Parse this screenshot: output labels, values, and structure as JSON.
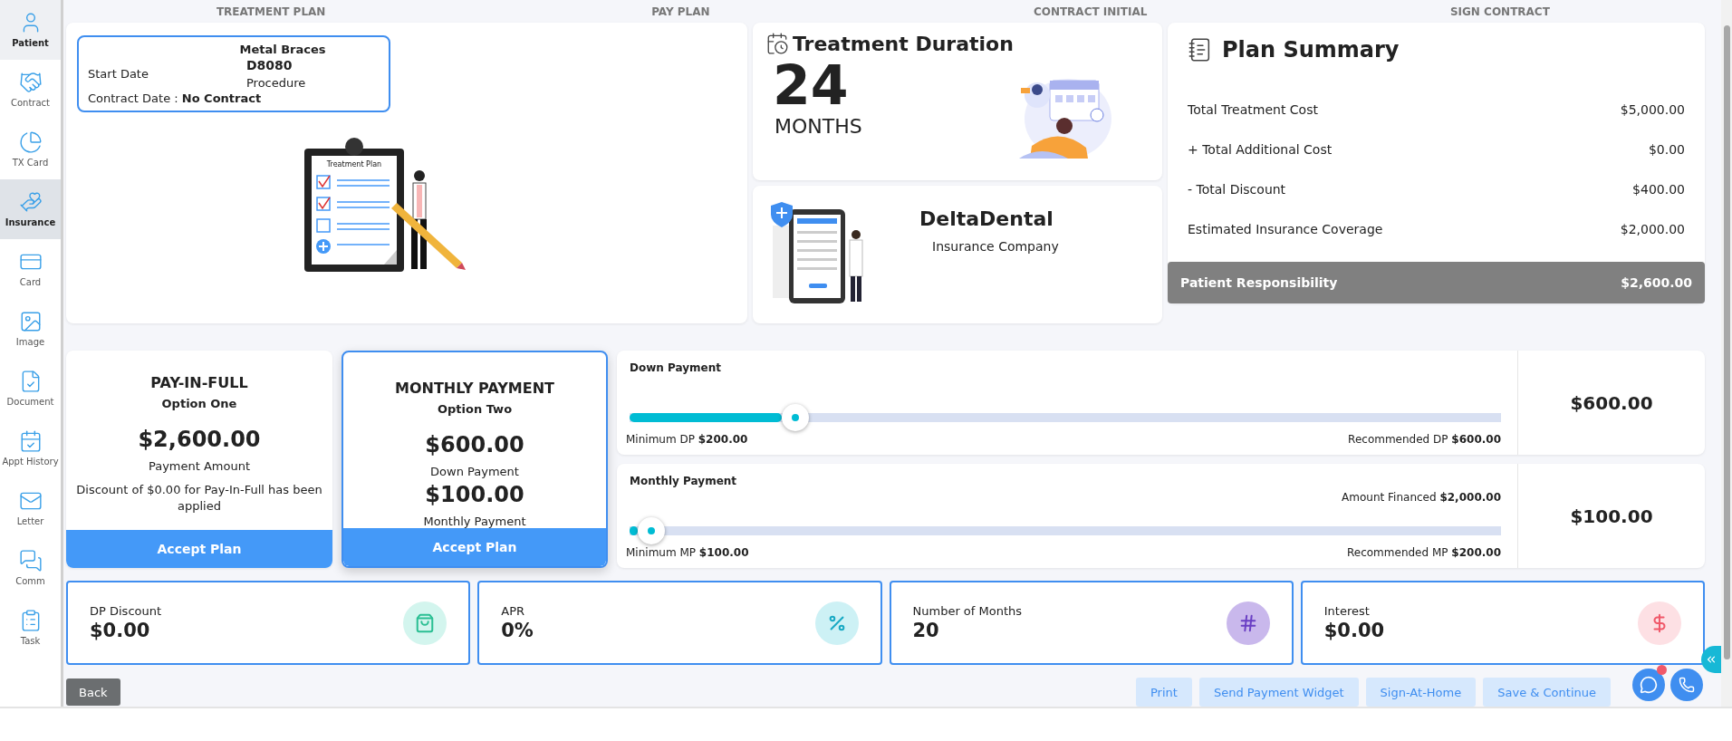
{
  "sidebar": {
    "items": [
      {
        "label": "Patient",
        "selected": false,
        "hovered": true
      },
      {
        "label": "Contract",
        "selected": false,
        "hovered": false
      },
      {
        "label": "TX Card",
        "selected": false,
        "hovered": false
      },
      {
        "label": "Insurance",
        "selected": true,
        "hovered": false
      },
      {
        "label": "Card",
        "selected": false,
        "hovered": false
      },
      {
        "label": "Image",
        "selected": false,
        "hovered": false
      },
      {
        "label": "Document",
        "selected": false,
        "hovered": false
      },
      {
        "label": "Appt History",
        "selected": false,
        "hovered": false
      },
      {
        "label": "Letter",
        "selected": false,
        "hovered": false
      },
      {
        "label": "Comm",
        "selected": false,
        "hovered": false
      },
      {
        "label": "Task",
        "selected": false,
        "hovered": false
      }
    ]
  },
  "steps": [
    "TREATMENT PLAN",
    "PAY PLAN",
    "CONTRACT INITIAL",
    "SIGN CONTRACT"
  ],
  "treatment": {
    "name": "Metal Braces",
    "start_label": "Start Date",
    "code": "D8080",
    "code_label": "Procedure",
    "contract_label": "Contract Date :",
    "contract_value": "No Contract",
    "illustration_title": "Treatment Plan"
  },
  "duration": {
    "title": "Treatment Duration",
    "value": "24",
    "unit": "MONTHS"
  },
  "insurance": {
    "name": "DeltaDental",
    "label": "Insurance Company"
  },
  "summary": {
    "title": "Plan Summary",
    "rows": [
      {
        "label": "Total Treatment Cost",
        "value": "$5,000.00"
      },
      {
        "label": "+ Total Additional Cost",
        "value": "$0.00"
      },
      {
        "label": "- Total Discount",
        "value": "$400.00"
      },
      {
        "label": "Estimated Insurance Coverage",
        "value": "$2,000.00"
      }
    ],
    "total_label": "Patient Responsibility",
    "total_value": "$2,600.00"
  },
  "options": [
    {
      "title": "PAY-IN-FULL",
      "subtitle": "Option One",
      "selected": false,
      "lines": [
        {
          "kind": "amount",
          "text": "$2,600.00"
        },
        {
          "kind": "label",
          "text": "Payment Amount"
        },
        {
          "kind": "note",
          "text": "Discount of $0.00 for Pay-In-Full has been applied"
        }
      ],
      "button": "Accept Plan"
    },
    {
      "title": "MONTHLY PAYMENT",
      "subtitle": "Option Two",
      "selected": true,
      "lines": [
        {
          "kind": "amount",
          "text": "$600.00"
        },
        {
          "kind": "label",
          "text": "Down Payment"
        },
        {
          "kind": "amount",
          "text": "$100.00"
        },
        {
          "kind": "label",
          "text": "Monthly Payment"
        }
      ],
      "button": "Accept Plan"
    }
  ],
  "sliders": [
    {
      "title": "Down Payment",
      "level": 0.18,
      "color": "#00bcd4",
      "min_label": "Minimum DP",
      "min_value": "$200.00",
      "rec_label": "Recommended DP",
      "rec_value": "$600.00",
      "value": "$600.00"
    },
    {
      "title": "Monthly Payment",
      "level": 0.01,
      "color": "#00bcd4",
      "top_right": {
        "label": "Amount Financed",
        "value": "$2,000.00"
      },
      "min_label": "Minimum MP",
      "min_value": "$100.00",
      "rec_label": "Recommended MP",
      "rec_value": "$200.00",
      "value": "$100.00"
    }
  ],
  "stats": [
    {
      "label": "DP Discount",
      "value": "$0.00",
      "kind": "bag",
      "color": "#d3f5ee"
    },
    {
      "label": "APR",
      "value": "0%",
      "kind": "percent",
      "color": "#cdf1f5"
    },
    {
      "label": "Number of Months",
      "value": "20",
      "kind": "hash",
      "color": "#c9b8ec"
    },
    {
      "label": "Interest",
      "value": "$0.00",
      "kind": "dollar",
      "color": "#fde0e4"
    }
  ],
  "footer": {
    "back": "Back",
    "buttons": [
      "Print",
      "Send Payment Widget",
      "Sign-At-Home",
      "Save & Continue"
    ]
  }
}
